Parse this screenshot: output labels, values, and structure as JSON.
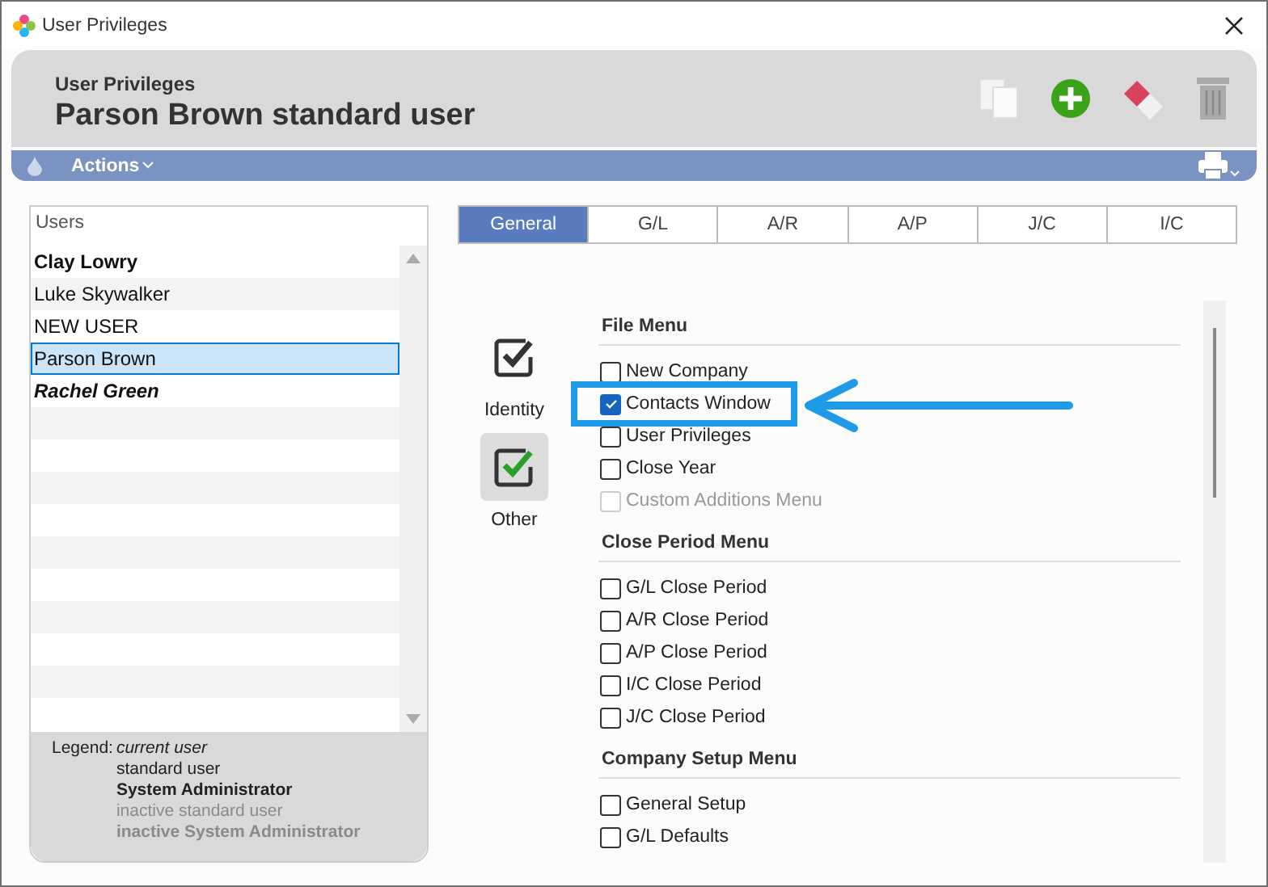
{
  "window": {
    "title": "User Privileges"
  },
  "header": {
    "subtitle": "User Privileges",
    "title": "Parson Brown standard user"
  },
  "toolbar": {
    "actions": "Actions"
  },
  "users": {
    "heading": "Users",
    "items": [
      {
        "name": "Clay Lowry",
        "admin": true,
        "current": false,
        "selected": false
      },
      {
        "name": "Luke Skywalker",
        "admin": false,
        "current": false,
        "selected": false
      },
      {
        "name": "NEW USER",
        "admin": false,
        "current": false,
        "selected": false
      },
      {
        "name": "Parson Brown",
        "admin": false,
        "current": false,
        "selected": true
      },
      {
        "name": "Rachel Green",
        "admin": true,
        "current": true,
        "selected": false
      }
    ]
  },
  "legend": {
    "label": "Legend:",
    "entries": [
      {
        "text": "current user",
        "kind": "current"
      },
      {
        "text": "standard user",
        "kind": "standard"
      },
      {
        "text": "System Administrator",
        "kind": "admin"
      },
      {
        "text": "inactive standard user",
        "kind": "inactive"
      },
      {
        "text": "inactive System Administrator",
        "kind": "inactive-admin"
      }
    ]
  },
  "tabs": [
    {
      "label": "General",
      "selected": true
    },
    {
      "label": "G/L",
      "selected": false
    },
    {
      "label": "A/R",
      "selected": false
    },
    {
      "label": "A/P",
      "selected": false
    },
    {
      "label": "J/C",
      "selected": false
    },
    {
      "label": "I/C",
      "selected": false
    }
  ],
  "categories": [
    {
      "label": "Identity",
      "selected": false
    },
    {
      "label": "Other",
      "selected": true
    }
  ],
  "sections": [
    {
      "title": "File Menu",
      "items": [
        {
          "label": "New Company",
          "checked": false,
          "disabled": false,
          "highlighted": false
        },
        {
          "label": "Contacts Window",
          "checked": true,
          "disabled": false,
          "highlighted": true
        },
        {
          "label": "User Privileges",
          "checked": false,
          "disabled": false,
          "highlighted": false
        },
        {
          "label": "Close Year",
          "checked": false,
          "disabled": false,
          "highlighted": false
        },
        {
          "label": "Custom Additions Menu",
          "checked": false,
          "disabled": true,
          "highlighted": false
        }
      ]
    },
    {
      "title": "Close Period Menu",
      "items": [
        {
          "label": "G/L Close Period",
          "checked": false,
          "disabled": false,
          "highlighted": false
        },
        {
          "label": "A/R Close Period",
          "checked": false,
          "disabled": false,
          "highlighted": false
        },
        {
          "label": "A/P Close Period",
          "checked": false,
          "disabled": false,
          "highlighted": false
        },
        {
          "label": "I/C Close Period",
          "checked": false,
          "disabled": false,
          "highlighted": false
        },
        {
          "label": "J/C Close Period",
          "checked": false,
          "disabled": false,
          "highlighted": false
        }
      ]
    },
    {
      "title": "Company Setup Menu",
      "items": [
        {
          "label": "General Setup",
          "checked": false,
          "disabled": false,
          "highlighted": false
        },
        {
          "label": "G/L Defaults",
          "checked": false,
          "disabled": false,
          "highlighted": false
        }
      ]
    }
  ]
}
